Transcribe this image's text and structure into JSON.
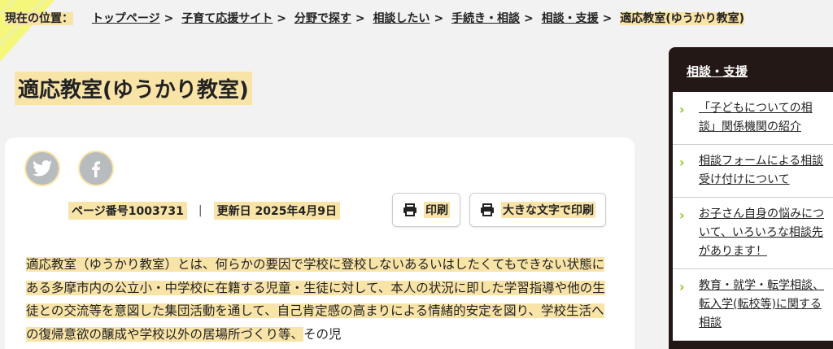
{
  "breadcrumb": {
    "here_label": "現在の位置：",
    "items": [
      "トップページ",
      "子育て応援サイト",
      "分野で探す",
      "相談したい",
      "手続き・相談",
      "相談・支援"
    ],
    "current": "適応教室(ゆうかり教室)"
  },
  "page": {
    "title": "適応教室(ゆうかり教室)",
    "page_number": "ページ番号1003731",
    "updated": "更新日 2025年4月9日",
    "print_label": "印刷",
    "print_large_label": "大きな文字で印刷",
    "body_highlight": "適応教室（ゆうかり教室）とは、何らかの要因で学校に登校しないあるいはしたくてもできない状態にある多摩市内の公立小・中学校に在籍する児童・生徒に対して、本人の状況に即した学習指導や他の生徒との交流等を意図した集団活動を通して、自己肯定感の高まりによる情緒的安定を図り、学校生活への復帰意欲の醸成や学校以外の居場所づくり等、",
    "body_rest": "その児"
  },
  "social": {
    "twitter_icon": "twitter-icon",
    "facebook_icon": "facebook-icon"
  },
  "sidebar": {
    "heading": "相談・支援",
    "items": [
      {
        "label": "「子どもについての相談」関係機関の紹介"
      },
      {
        "label": "相談フォームによる相談受け付けについて"
      },
      {
        "label": "お子さん自身の悩みについて、いろいろな相談先があります！"
      },
      {
        "label": "教育・就学・転学相談、転入学(転校等)に関する相談"
      }
    ]
  },
  "colors": {
    "highlight": "#f9e4a8",
    "sidebar_bg": "#231815",
    "chevron": "#8ec31f"
  }
}
